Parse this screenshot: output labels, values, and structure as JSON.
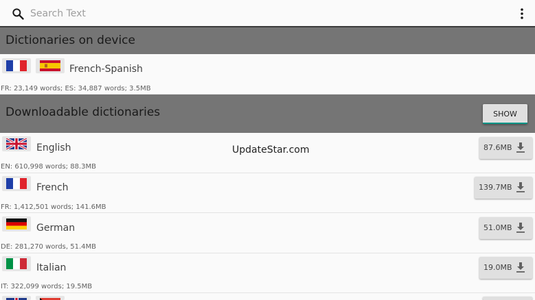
{
  "search": {
    "placeholder": "Search Text"
  },
  "sections": {
    "on_device": {
      "title": "Dictionaries on device"
    },
    "downloadable": {
      "title": "Downloadable dictionaries",
      "show_label": "SHOW"
    }
  },
  "device_items": [
    {
      "name": "French-Spanish",
      "flags": [
        "flag-france-icon",
        "flag-spain-icon"
      ],
      "info": "FR: 23,149 words; ES: 34,887 words; 3.5MB"
    }
  ],
  "download_items": [
    {
      "name": "English",
      "flag": "flag-uk-icon",
      "info": "EN: 610,998 words; 88.3MB",
      "size": "87.6MB"
    },
    {
      "name": "French",
      "flag": "flag-france-icon",
      "info": "FR: 1,412,501 words; 141.6MB",
      "size": "139.7MB"
    },
    {
      "name": "German",
      "flag": "flag-germany-icon",
      "info": "DE: 281,270 words, 51.4MB",
      "size": "51.0MB"
    },
    {
      "name": "Italian",
      "flag": "flag-italy-icon",
      "info": "IT: 322,099 words; 19.5MB",
      "size": "19.0MB"
    }
  ],
  "watermark": "UpdateStar.com",
  "colors": {
    "section_header": "#757575",
    "accent": "#009688",
    "button": "#e0e0e0"
  }
}
